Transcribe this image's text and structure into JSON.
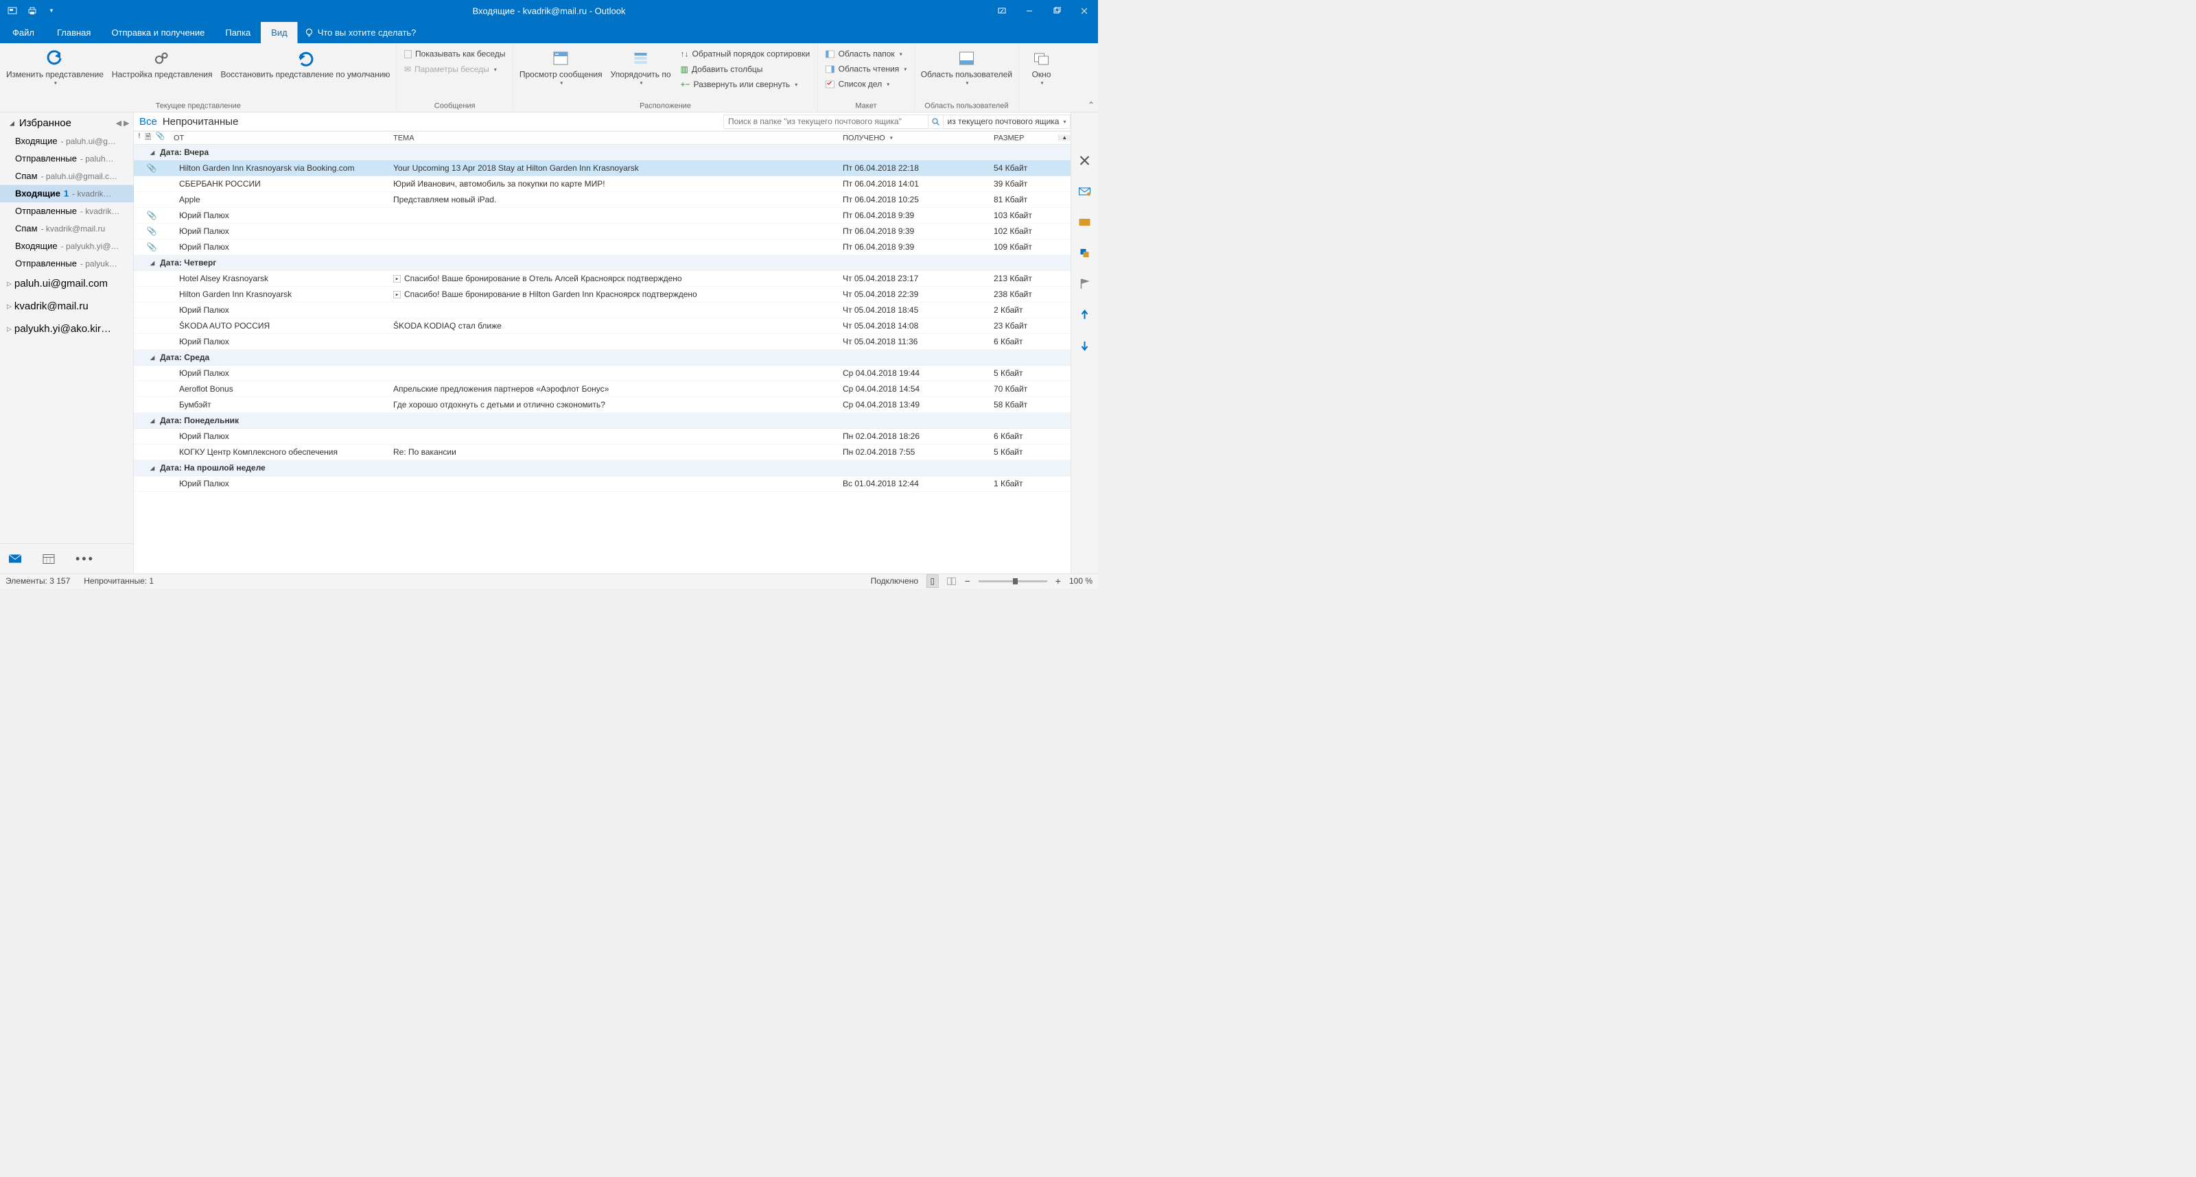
{
  "title": "Входящие - kvadrik@mail.ru  -  Outlook",
  "menu": {
    "file": "Файл",
    "home": "Главная",
    "sendrecv": "Отправка и получение",
    "folder": "Папка",
    "view": "Вид",
    "tellme": "Что вы хотите сделать?"
  },
  "ribbon": {
    "g1": {
      "label": "Текущее представление",
      "changeView": "Изменить представление",
      "viewSettings": "Настройка представления",
      "resetView": "Восстановить представление по умолчанию"
    },
    "g2": {
      "label": "Сообщения",
      "showConv": "Показывать как беседы",
      "convSettings": "Параметры беседы"
    },
    "g3": {
      "label": "Расположение",
      "preview": "Просмотр сообщения",
      "arrange": "Упорядочить по",
      "reverse": "Обратный порядок сортировки",
      "addCols": "Добавить столбцы",
      "expand": "Развернуть или свернуть"
    },
    "g4": {
      "label": "Макет",
      "folderPane": "Область папок",
      "readingPane": "Область чтения",
      "todo": "Список дел"
    },
    "g5": {
      "label": "Область пользователей",
      "peoplePane": "Область пользователей"
    },
    "g6": {
      "window": "Окно"
    }
  },
  "sidebar": {
    "fav": "Избранное",
    "items": [
      {
        "name": "Входящие",
        "sub": "- paluh.ui@g…"
      },
      {
        "name": "Отправленные",
        "sub": "- paluh…"
      },
      {
        "name": "Спам",
        "sub": "- paluh.ui@gmail.c…"
      },
      {
        "name": "Входящие",
        "count": "1",
        "sub": "- kvadrik…",
        "selected": true,
        "bold": true
      },
      {
        "name": "Отправленные",
        "sub": "- kvadrik…"
      },
      {
        "name": "Спам",
        "sub": "- kvadrik@mail.ru"
      },
      {
        "name": "Входящие",
        "sub": "- palyukh.yi@…"
      },
      {
        "name": "Отправленные",
        "sub": "- palyuk…"
      }
    ],
    "accounts": [
      "paluh.ui@gmail.com",
      "kvadrik@mail.ru",
      "palyukh.yi@ako.kir…"
    ]
  },
  "filters": {
    "all": "Все",
    "unread": "Непрочитанные"
  },
  "search": {
    "placeholder": "Поиск в папке \"из текущего почтового ящика\"",
    "scope": "из текущего почтового ящика"
  },
  "cols": {
    "from": "ОТ",
    "subj": "ТЕМА",
    "recv": "ПОЛУЧЕНО",
    "size": "РАЗМЕР"
  },
  "groups": [
    {
      "label": "Дата: Вчера",
      "rows": [
        {
          "att": true,
          "from": "Hilton Garden Inn Krasnoyarsk via Booking.com",
          "subj": "Your Upcoming 13 Apr 2018 Stay at Hilton Garden Inn Krasnoyarsk",
          "recv": "Пт 06.04.2018 22:18",
          "size": "54 Кбайт",
          "sel": true
        },
        {
          "from": "СБЕРБАНК РОССИИ",
          "subj": "Юрий Иванович, автомобиль за покупки по карте МИР!",
          "recv": "Пт 06.04.2018 14:01",
          "size": "39 Кбайт"
        },
        {
          "from": "Apple",
          "subj": "Представляем новый iPad.",
          "recv": "Пт 06.04.2018 10:25",
          "size": "81 Кбайт"
        },
        {
          "att": true,
          "from": "Юрий Палюх",
          "subj": "",
          "recv": "Пт 06.04.2018 9:39",
          "size": "103 Кбайт"
        },
        {
          "att": true,
          "from": "Юрий Палюх",
          "subj": "",
          "recv": "Пт 06.04.2018 9:39",
          "size": "102 Кбайт"
        },
        {
          "att": true,
          "from": "Юрий Палюх",
          "subj": "",
          "recv": "Пт 06.04.2018 9:39",
          "size": "109 Кбайт"
        }
      ]
    },
    {
      "label": "Дата: Четверг",
      "rows": [
        {
          "pv": true,
          "from": "Hotel Alsey Krasnoyarsk",
          "subj": "Спасибо! Ваше бронирование в Отель Алсей Красноярск подтверждено",
          "recv": "Чт 05.04.2018 23:17",
          "size": "213 Кбайт"
        },
        {
          "pv": true,
          "from": "Hilton Garden Inn Krasnoyarsk",
          "subj": "Спасибо! Ваше бронирование в Hilton Garden Inn Красноярск подтверждено",
          "recv": "Чт 05.04.2018 22:39",
          "size": "238 Кбайт"
        },
        {
          "from": "Юрий Палюх",
          "subj": "",
          "recv": "Чт 05.04.2018 18:45",
          "size": "2 Кбайт"
        },
        {
          "from": "ŠKODA AUTO РОССИЯ",
          "subj": "ŠKODA KODIAQ стал ближе",
          "recv": "Чт 05.04.2018 14:08",
          "size": "23 Кбайт"
        },
        {
          "from": "Юрий Палюх",
          "subj": "",
          "recv": "Чт 05.04.2018 11:36",
          "size": "6 Кбайт"
        }
      ]
    },
    {
      "label": "Дата: Среда",
      "rows": [
        {
          "from": "Юрий Палюх",
          "subj": "",
          "recv": "Ср 04.04.2018 19:44",
          "size": "5 Кбайт"
        },
        {
          "from": "Aeroflot Bonus",
          "subj": "Апрельские предложения партнеров «Аэрофлот Бонус»",
          "recv": "Ср 04.04.2018 14:54",
          "size": "70 Кбайт"
        },
        {
          "from": "Бумбэйт",
          "subj": "Где хорошо отдохнуть с детьми и отлично сэкономить?",
          "recv": "Ср 04.04.2018 13:49",
          "size": "58 Кбайт"
        }
      ]
    },
    {
      "label": "Дата: Понедельник",
      "rows": [
        {
          "from": "Юрий Палюх",
          "subj": "",
          "recv": "Пн 02.04.2018 18:26",
          "size": "6 Кбайт"
        },
        {
          "from": "КОГКУ Центр Комплексного обеспечения",
          "subj": "Re: По вакансии",
          "recv": "Пн 02.04.2018 7:55",
          "size": "5 Кбайт"
        }
      ]
    },
    {
      "label": "Дата: На прошлой неделе",
      "rows": [
        {
          "from": "Юрий Палюх",
          "subj": "",
          "recv": "Вс 01.04.2018 12:44",
          "size": "1 Кбайт"
        }
      ]
    }
  ],
  "status": {
    "items": "Элементы: 3 157",
    "unread": "Непрочитанные: 1",
    "connected": "Подключено",
    "zoom": "100 %"
  }
}
